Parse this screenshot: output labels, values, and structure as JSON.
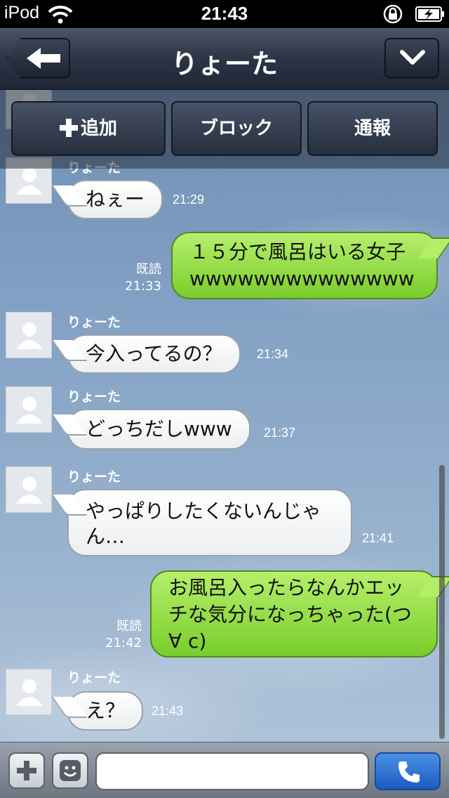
{
  "status": {
    "carrier": "iPod",
    "time": "21:43"
  },
  "nav": {
    "title": "りょーた"
  },
  "actions": {
    "add": "追加",
    "block": "ブロック",
    "report": "通報"
  },
  "messages": [
    {
      "side": "in",
      "sender": "りょーた",
      "text": "ねぇー",
      "time": "21:29"
    },
    {
      "side": "out",
      "text": "１５分で風呂はいる女子wwwwwwwwwwwwww",
      "read": "既読",
      "time": "21:33"
    },
    {
      "side": "in",
      "sender": "りょーた",
      "text": "今入ってるの？",
      "time": "21:34"
    },
    {
      "side": "in",
      "sender": "りょーた",
      "text": "どっちだしwww",
      "time": "21:37"
    },
    {
      "side": "in",
      "sender": "りょーた",
      "text": "やっぱりしたくないんじゃん…",
      "time": "21:41"
    },
    {
      "side": "out",
      "text": "お風呂入ったらなんかエッチな気分になっちゃった(つ∀ c)",
      "read": "既読",
      "time": "21:42"
    },
    {
      "side": "in",
      "sender": "りょーた",
      "text": "え？",
      "time": "21:43"
    }
  ],
  "partial_sender": "りょーた",
  "input": {
    "value": "",
    "placeholder": ""
  },
  "colors": {
    "navbar": "#2c3546",
    "bubble_out": "#8ed83f",
    "bubble_in": "#ffffff",
    "call": "#2f75d6"
  }
}
